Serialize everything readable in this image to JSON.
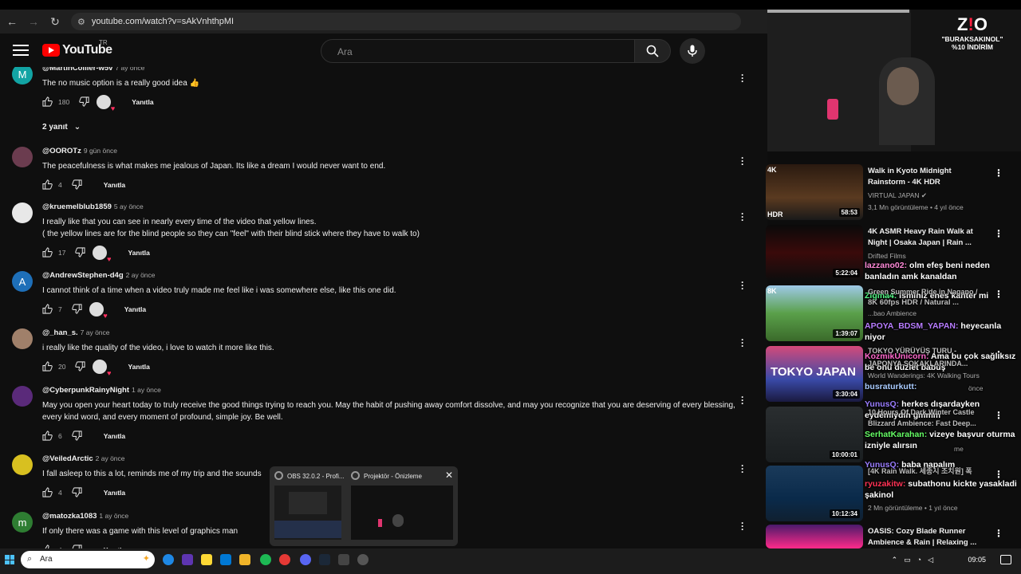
{
  "browser": {
    "url": "youtube.com/watch?v=sAkVnhthpMI"
  },
  "header": {
    "logo": "YouTube",
    "country": "TR",
    "search_placeholder": "Ara"
  },
  "comments": [
    {
      "author": "@MartinCollier-w5v",
      "time": "7 ay önce",
      "text": "The no music option is a really good idea 👍",
      "likes": "180",
      "hearted": true,
      "reply": "Yanıtla",
      "avatar_letter": "M",
      "avatar_color": "#12a4a4"
    },
    {
      "author": "@OOROTz",
      "time": "9 gün önce",
      "text": "The peacefulness is what makes me jealous of Japan. Its like a dream I would never want to end.",
      "likes": "4",
      "hearted": false,
      "reply": "Yanıtla",
      "avatar_letter": "",
      "avatar_color": "#6b3c4f"
    },
    {
      "author": "@kruemelblub1859",
      "time": "5 ay önce",
      "text": "I really like that you can see in nearly every time of the video that yellow lines.",
      "text2": "( the yellow lines are for the blind people so they can \"feel\" with their blind stick where they have to walk to)",
      "likes": "17",
      "hearted": true,
      "reply": "Yanıtla",
      "avatar_letter": "",
      "avatar_color": "#e8e8e8"
    },
    {
      "author": "@AndrewStephen-d4g",
      "time": "2 ay önce",
      "text": "I cannot think of a time when a video truly made me feel like i was somewhere else, like this one did.",
      "likes": "7",
      "hearted": true,
      "reply": "Yanıtla",
      "avatar_letter": "A",
      "avatar_color": "#1e6fb8"
    },
    {
      "author": "@_han_s.",
      "time": "7 ay önce",
      "text": "i really like the quality of the video, i love to watch it more like this.",
      "likes": "20",
      "hearted": true,
      "reply": "Yanıtla",
      "avatar_letter": "",
      "avatar_color": "#a0806a"
    },
    {
      "author": "@CyberpunkRainyNight",
      "time": "1 ay önce",
      "text": "May you open your heart today to truly receive the good things trying to reach you. May the habit of pushing away comfort dissolve, and may you recognize that you are deserving of every blessing, every kind word, and every moment of profound, simple joy. Be well.",
      "likes": "6",
      "hearted": false,
      "reply": "Yanıtla",
      "avatar_letter": "",
      "avatar_color": "#5a2a7a"
    },
    {
      "author": "@VeiledArctic",
      "time": "2 ay önce",
      "text": "I fall asleep to this a lot, reminds me of my trip and the sounds",
      "likes": "4",
      "hearted": false,
      "reply": "Yanıtla",
      "avatar_letter": "",
      "avatar_color": "#d8c020"
    },
    {
      "author": "@matozka1083",
      "time": "1 ay önce",
      "text": "If only there was a game with this level of graphics man",
      "likes": "4",
      "hearted": false,
      "reply": "Yanıtla",
      "avatar_letter": "m",
      "avatar_color": "#2e7d32"
    }
  ],
  "replies_toggle": "2 yanıt",
  "sponsor": {
    "code": "\"BURAKSAKINOL\"",
    "discount": "%10 İNDİRİM"
  },
  "videos": [
    {
      "title1": "Walk in Kyoto Midnight",
      "title2": "Rainstorm - 4K HDR",
      "channel": "VIRTUAL JAPAN",
      "meta": "3,1 Mn görüntüleme • 4 yıl önce",
      "duration": "58:53",
      "badge": "4K",
      "badge2": "HDR"
    },
    {
      "title1": "4K ASMR Heavy Rain Walk at",
      "title2": "Night | Osaka Japan | Rain ...",
      "channel": "Drifted Films",
      "meta": "",
      "duration": "5:22:04"
    },
    {
      "title1": "",
      "title2": "",
      "channel": "...bao Ambience",
      "meta": "",
      "duration": "1:39:07",
      "badge": "8K"
    },
    {
      "title1": "",
      "title2": "",
      "channel": "World Wanderings: 4K Walking Tours",
      "meta": "",
      "duration": "3:30:04",
      "thumb_text": "TOKYO JAPAN"
    },
    {
      "title1": "",
      "title2": "",
      "channel": "",
      "meta": "",
      "duration": "10:00:01"
    },
    {
      "title1": "",
      "title2": "",
      "channel": "",
      "meta": "2 Mn görüntüleme • 1 yıl önce",
      "duration": "10:12:34"
    },
    {
      "title1": "OASIS: Cozy Blade Runner",
      "title2": "Ambience & Rain | Relaxing ...",
      "channel": "",
      "meta": "",
      "duration": ""
    }
  ],
  "chat": [
    {
      "name": "lazzano02:",
      "text": " olm efeş beni neden banladın amk kanaldan",
      "color": "#ff8ad8"
    },
    {
      "name": "Zigma4:",
      "text": " isminiz enes kanter mi",
      "color": "#55ff88"
    },
    {
      "name": "APOYA_BDSM_YAPAN:",
      "text": " heyecanla niyor",
      "color": "#b77cff"
    },
    {
      "name": "KozmikUnicorn:",
      "text": " Ama bu çok sağlıksız be onu düzlet babuş",
      "color": "#ff66cc"
    },
    {
      "name": "busraturkutt:",
      "text": "",
      "color": "#aaccff"
    },
    {
      "name": "YunusQ:",
      "text": " herkes dışardayken eydemiydin gmmm",
      "color": "#9a7dff"
    },
    {
      "name": "SerhatKarahan:",
      "text": " vizeye başvur oturma izniyle alırsın",
      "color": "#66ff66"
    },
    {
      "name": "YunusQ:",
      "text": " baba napalım",
      "color": "#9a7dff"
    },
    {
      "name": "ryuzakitw:",
      "text": " subathonu kickte yasakladi şakinol",
      "color": "#ff3355"
    }
  ],
  "chat_overlay_fragments": {
    "green_summer": "Green Summer Ride in Nagano /",
    "natural": "8K 60fps HDR / Natural ...",
    "tokyo": "TOKYO YÜRÜYÜŞ TURU -",
    "japonya": "JAPONYA SOKAKLARINDA...",
    "once": "önce",
    "winter": "10 Hours Of Dark Winter Castle",
    "blizzard": "Blizzard Ambience: Fast Deep...",
    "rainwalk": "[4K Rain Walk. 세종시 조치원] 폭",
    "me": "me"
  },
  "preview": {
    "obs_title": "OBS 32.0.2 - Profi...",
    "proj_title": "Projektör - Önizleme"
  },
  "taskbar": {
    "search": "Ara",
    "time": "09:05"
  }
}
